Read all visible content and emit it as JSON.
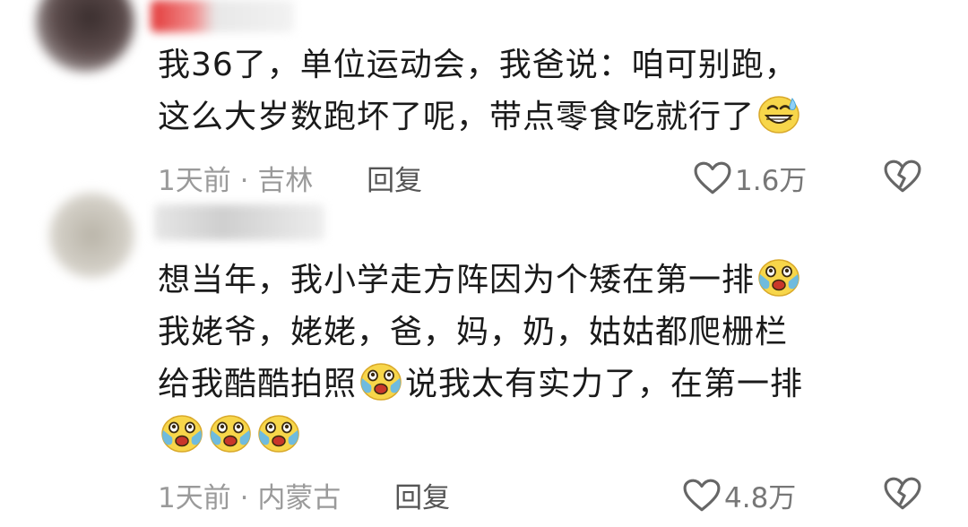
{
  "comments": [
    {
      "lines": [
        "我36了，单位运动会，我爸说：咱可别跑，",
        "这么大岁数跑坏了呢，带点零食吃就行了"
      ],
      "time": "1天前",
      "location": "吉林",
      "reply_label": "回复",
      "likes": "1.6万"
    },
    {
      "lines": [
        "想当年，我小学走方阵因为个矮在第一排",
        "我姥爷，姥姥，爸，妈，奶，姑姑都爬栅栏",
        "给我酷酷拍照",
        "说我太有实力了，在第一排"
      ],
      "time": "1天前",
      "location": "内蒙古",
      "reply_label": "回复",
      "likes": "4.8万"
    }
  ],
  "meta_separator": "·",
  "icons": {
    "emoji_1": "grinning-sweat-emoji",
    "emoji_2": "tears-of-joy-emoji",
    "like": "heart-outline-icon",
    "dislike": "broken-heart-icon"
  },
  "colors": {
    "text": "#1a1a1a",
    "meta": "#9a9a9a",
    "emoji_yellow": "#f7d64a"
  }
}
